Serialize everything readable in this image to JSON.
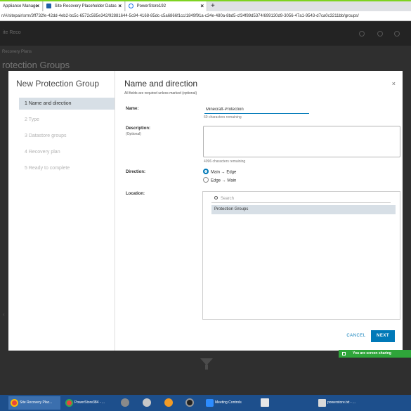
{
  "browser": {
    "tabs": [
      {
        "label": "Appliance Manage",
        "color": "#4a90d9"
      },
      {
        "label": "Site Recovery Placeholder Datas",
        "color": "#1f5fa6"
      },
      {
        "label": "PowerStore192",
        "color": "#1a73e8"
      }
    ],
    "new_tab": "+",
    "url": "n/#/sitepair/srm/3ff732fe-42dd-4eb2-bc5c-6572c585e342/92881644-5c94-4168-85dc-c5a6866f1cc/1849f91a-c34e-480a-8bd5-cf34f89d5374/699130d9-3056-47a1-9543-d7ca0c3211bb/groups/"
  },
  "background": {
    "product": "ite Reco",
    "breadcrumb": "Recovery Plans",
    "title": "rotection Groups"
  },
  "wizard": {
    "title": "New Protection Group",
    "steps": [
      {
        "label": "1  Name and direction",
        "active": true
      },
      {
        "label": "2  Type",
        "active": false
      },
      {
        "label": "3  Datastore groups",
        "active": false
      },
      {
        "label": "4  Recovery plan",
        "active": false
      },
      {
        "label": "5  Ready to complete",
        "active": false
      }
    ],
    "page_title": "Name and direction",
    "page_subtitle": "All fields are required unless marked (optional)",
    "close_glyph": "×",
    "name_label": "Name:",
    "name_value": "Minecraft-Protection",
    "name_hint": "60 characters remaining",
    "description_label": "Description:",
    "description_optional": "(Optional)",
    "description_value": "",
    "description_hint": "4096 characters remaining",
    "direction_label": "Direction:",
    "direction_options": [
      {
        "label": "Main → Edge",
        "selected": true
      },
      {
        "label": "Edge → Main",
        "selected": false
      }
    ],
    "location_label": "Location:",
    "search_placeholder": "Search",
    "tree_items": [
      "Protection Groups"
    ],
    "cancel_label": "CANCEL",
    "next_label": "NEXT"
  },
  "screen_sharing": "You are screen sharing",
  "taskbar": {
    "items": [
      {
        "label": "Site Recovery Plac...",
        "active": true
      },
      {
        "label": "PowerStore384 - ...",
        "active": false
      },
      {
        "label": "Meeting Controls",
        "active": false
      },
      {
        "label": "powerstore.txt - ...",
        "active": false
      }
    ]
  },
  "colors": {
    "accent": "#0079b8",
    "selected_row": "#d7dfe6",
    "taskbar": "#1d4f8c",
    "share_green": "#2fa53a"
  }
}
